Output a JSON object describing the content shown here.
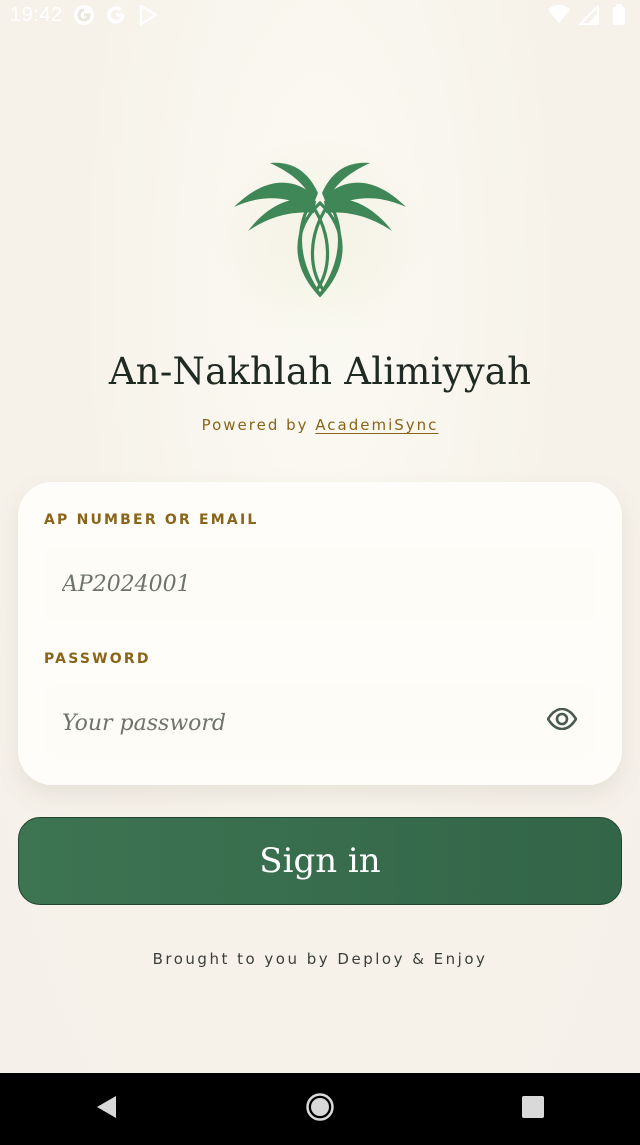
{
  "status_bar": {
    "time": "19:42",
    "icons": [
      "g-circle-icon",
      "google-g-icon",
      "play-store-icon",
      "wifi-icon",
      "cell-signal-icon",
      "battery-icon"
    ]
  },
  "brand": {
    "title": "An-Nakhlah Alimiyyah",
    "powered_prefix": "Powered by ",
    "powered_link": "AcademiSync",
    "logo_icon": "palm-tree-logo-icon",
    "primary_color": "#3d7452",
    "accent_color": "#8a6418"
  },
  "form": {
    "username_label": "AP NUMBER OR EMAIL",
    "username_placeholder": "AP2024001",
    "username_value": "",
    "password_label": "PASSWORD",
    "password_placeholder": "Your password",
    "password_value": "",
    "show_password_icon": "eye-icon"
  },
  "actions": {
    "sign_in_label": "Sign in"
  },
  "footer": {
    "credit": "Brought to you by Deploy & Enjoy"
  },
  "nav_bar": {
    "icons": [
      "back-icon",
      "home-icon",
      "recents-icon"
    ]
  }
}
